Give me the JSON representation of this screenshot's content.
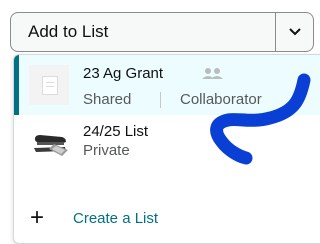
{
  "add_to_list": {
    "label": "Add to List",
    "dropdown_icon": "chevron-down-icon"
  },
  "lists": [
    {
      "name": "23 Ag Grant",
      "shared_label": "Shared",
      "role": "Collaborator",
      "thumbnail_icon": "list-placeholder-icon",
      "people_icon": "people-icon",
      "selected": true
    },
    {
      "name": "24/25 List",
      "privacy": "Private",
      "thumbnail_icon": "stapler-icon"
    }
  ],
  "create_list": {
    "plus_icon": "plus-icon",
    "label": "Create a List"
  },
  "colors": {
    "link": "#007185",
    "selected_bg": "#edfdff",
    "annotation": "#0a3fd6"
  }
}
